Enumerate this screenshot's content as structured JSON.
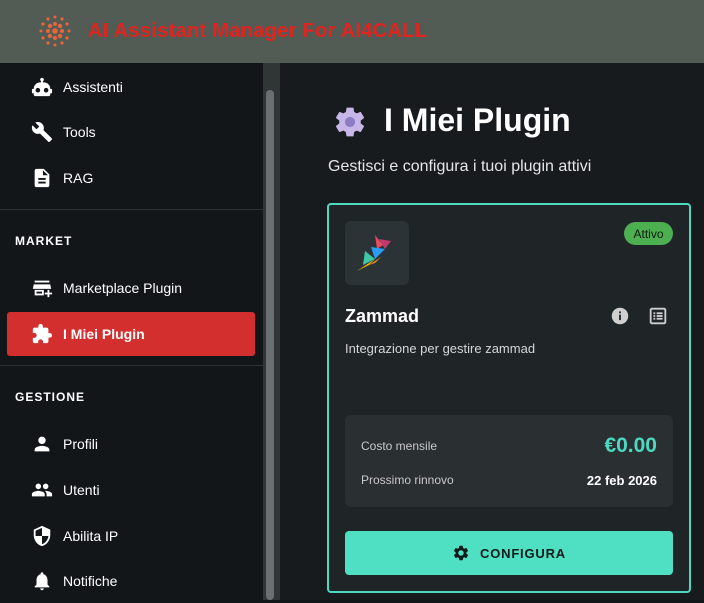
{
  "app": {
    "title": "AI Assistant Manager For AI4CALL"
  },
  "sidebar": {
    "items_top": [
      {
        "label": "Assistenti",
        "icon": "robot-icon"
      },
      {
        "label": "Tools",
        "icon": "wrench-icon"
      },
      {
        "label": "RAG",
        "icon": "document-icon"
      }
    ],
    "market_label": "MARKET",
    "market_items": [
      {
        "label": "Marketplace Plugin",
        "icon": "store-add-icon"
      },
      {
        "label": "I Miei Plugin",
        "icon": "puzzle-icon",
        "active": true
      }
    ],
    "gestione_label": "GESTIONE",
    "gestione_items": [
      {
        "label": "Profili",
        "icon": "person-icon"
      },
      {
        "label": "Utenti",
        "icon": "people-icon"
      },
      {
        "label": "Abilita IP",
        "icon": "shield-icon"
      },
      {
        "label": "Notifiche",
        "icon": "bell-icon"
      }
    ]
  },
  "main": {
    "title": "I Miei Plugin",
    "subtitle": "Gestisci e configura i tuoi plugin attivi"
  },
  "plugin": {
    "name": "Zammad",
    "status": "Attivo",
    "description": "Integrazione per gestire zammad",
    "cost_label": "Costo mensile",
    "cost_value": "€0.00",
    "renew_label": "Prossimo rinnovo",
    "renew_value": "22 feb 2026",
    "configure_label": "CONFIGURA"
  },
  "colors": {
    "accent": "#4fdfc3",
    "active_nav": "#d32f2f",
    "badge": "#4caf50",
    "title_red": "#e0241f"
  }
}
